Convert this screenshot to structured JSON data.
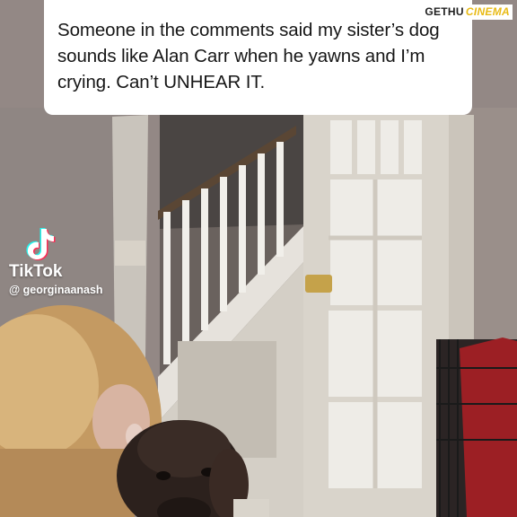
{
  "caption": {
    "text": "Someone in the comments said my sister’s dog sounds like Alan Carr when he yawns and I’m crying. Can’t UNHEAR IT."
  },
  "watermark": {
    "brand_part1": "GETHU",
    "brand_part2": "CINEMA",
    "platform_name": "TikTok",
    "handle": "@ georginaanash",
    "platform_icon": "tiktok-note-icon"
  },
  "colors": {
    "caption_bg": "#ffffff",
    "caption_text": "#161616",
    "brand_accent": "#e8ba14",
    "overlay_text": "#ffffff"
  }
}
